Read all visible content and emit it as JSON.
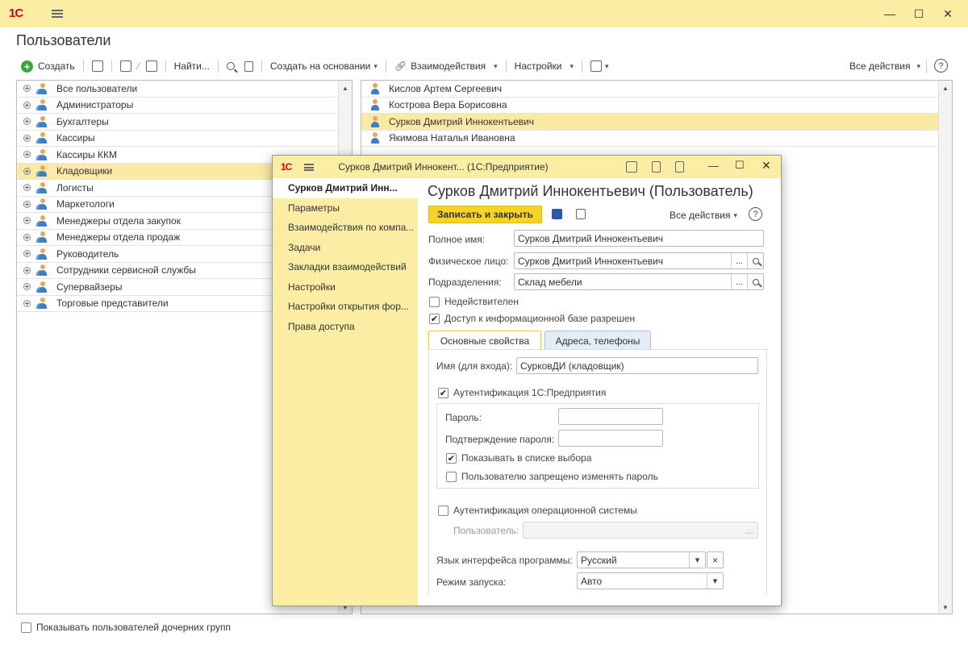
{
  "app": {
    "logo": "1С"
  },
  "page": {
    "title": "Пользователи"
  },
  "toolbar": {
    "create": "Создать",
    "find": "Найти...",
    "create_based_on": "Создать на основании",
    "interactions": "Взаимодействия",
    "settings": "Настройки",
    "all_actions": "Все действия",
    "help": "?"
  },
  "groups": [
    {
      "label": "Все пользователи"
    },
    {
      "label": "Администраторы"
    },
    {
      "label": "Бухгалтеры"
    },
    {
      "label": "Кассиры"
    },
    {
      "label": "Кассиры ККМ"
    },
    {
      "label": "Кладовщики",
      "selected": true
    },
    {
      "label": "Логисты"
    },
    {
      "label": "Маркетологи"
    },
    {
      "label": "Менеджеры отдела закупок"
    },
    {
      "label": "Менеджеры отдела продаж"
    },
    {
      "label": "Руководитель"
    },
    {
      "label": "Сотрудники сервисной службы"
    },
    {
      "label": "Супервайзеры"
    },
    {
      "label": "Торговые представители"
    }
  ],
  "users": [
    {
      "name": "Кислов Артем Сергеевич"
    },
    {
      "name": "Кострова Вера Борисовна"
    },
    {
      "name": "Сурков Дмитрий Иннокентьевич",
      "selected": true
    },
    {
      "name": "Якимова Наталья Ивановна"
    }
  ],
  "footer": {
    "show_children": "Показывать пользователей дочерних групп"
  },
  "dialog": {
    "window_title": "Сурков Дмитрий Иннокент...  (1С:Предприятие)",
    "heading": "Сурков Дмитрий Иннокентьевич (Пользователь)",
    "nav": [
      {
        "label": "Сурков Дмитрий Инн...",
        "active": true
      },
      {
        "label": "Параметры"
      },
      {
        "label": "Взаимодействия по компа..."
      },
      {
        "label": "Задачи"
      },
      {
        "label": "Закладки взаимодействий"
      },
      {
        "label": "Настройки"
      },
      {
        "label": "Настройки открытия фор..."
      },
      {
        "label": "Права доступа"
      }
    ],
    "save_close": "Записать и закрыть",
    "all_actions": "Все действия",
    "full_name_label": "Полное имя:",
    "full_name": "Сурков Дмитрий Иннокентьевич",
    "person_label": "Физическое лицо:",
    "person": "Сурков Дмитрий Иннокентьевич",
    "division_label": "Подразделения:",
    "division": "Склад мебели",
    "invalid_label": "Недействителен",
    "access_label": "Доступ к информационной базе разрешен",
    "tabs": [
      "Основные свойства",
      "Адреса, телефоны"
    ],
    "login_label": "Имя (для входа):",
    "login": "СурковДИ (кладовщик)",
    "auth_1c": "Аутентификация 1С:Предприятия",
    "password_label": "Пароль:",
    "password_confirm_label": "Подтверждение пароля:",
    "show_in_list": "Показывать в списке выбора",
    "cannot_change_pw": "Пользователю запрещено изменять пароль",
    "auth_os": "Аутентификация операционной системы",
    "os_user_label": "Пользователь:",
    "lang_label": "Язык интерфейса программы:",
    "lang": "Русский",
    "mode_label": "Режим запуска:",
    "mode": "Авто",
    "ellipsis": "...",
    "clear": "×",
    "dropdown": "▾",
    "checked_mark": "✔"
  }
}
